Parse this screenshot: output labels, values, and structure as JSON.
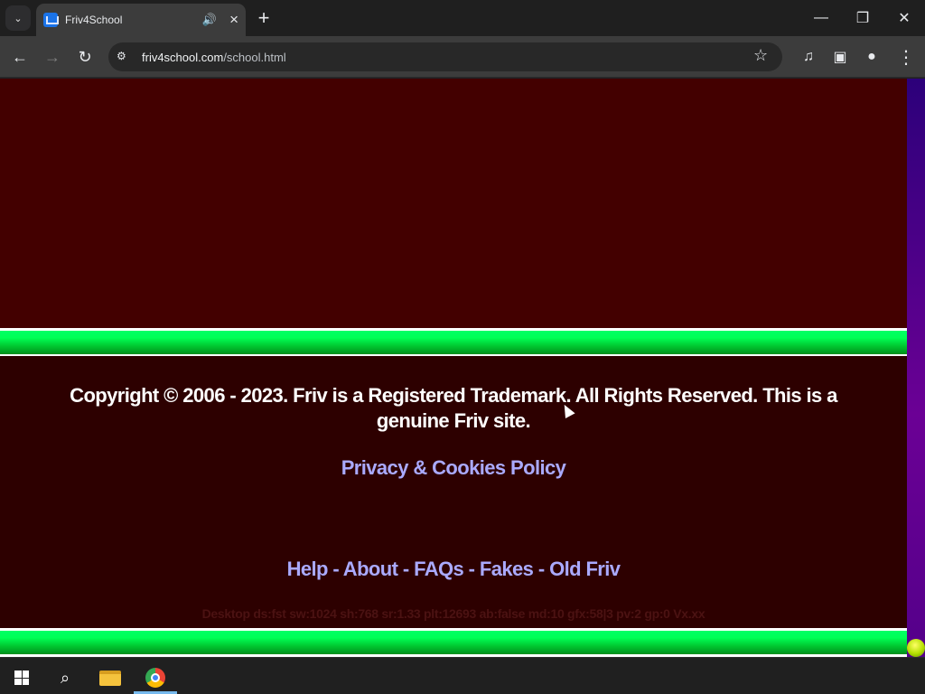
{
  "browser": {
    "tab": {
      "title": "Friv4School"
    },
    "address": {
      "host": "friv4school.com",
      "path": "/school.html"
    },
    "window_controls": {
      "minimize": "—",
      "maximize": "❐",
      "close": "✕"
    },
    "icons": {
      "tab_search": "chevron-down-icon",
      "audio": "speaker-icon",
      "close": "close-icon",
      "new_tab": "plus-icon",
      "back": "arrow-left-icon",
      "forward": "arrow-right-icon",
      "reload": "reload-icon",
      "site_info": "settings-sliders-icon",
      "bookmark": "star-icon",
      "media": "media-queue-icon",
      "side_panel": "side-panel-icon",
      "profile": "profile-icon",
      "menu": "more-vertical-icon"
    }
  },
  "page": {
    "copyright": "Copyright © 2006 - 2023. Friv is a Registered Trademark. All Rights Reserved. This is a genuine Friv site.",
    "privacy": "Privacy & Cookies Policy",
    "footer_links": [
      "Help",
      "About",
      "FAQs",
      "Fakes",
      "Old Friv"
    ],
    "separator": " - ",
    "debug": "Desktop ds:fst sw:1024 sh:768 sr:1.33 plt:12693 ab:false md:10 gfx:58|3 pv:2 gp:0 Vx.xx",
    "colors": {
      "panel": "#430000",
      "footer": "#2d0000",
      "divider": "#00ff66",
      "link": "#aaaaff",
      "text": "#ffffff"
    }
  },
  "taskbar": {
    "items": [
      "start-icon",
      "search-icon",
      "file-explorer-icon",
      "chrome-icon"
    ]
  }
}
